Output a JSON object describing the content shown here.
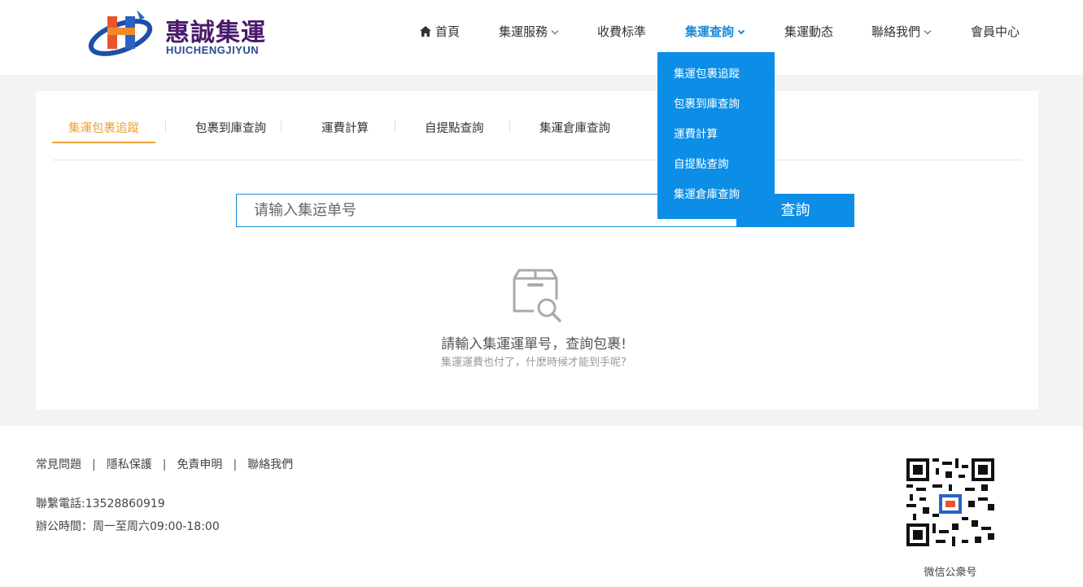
{
  "brand": {
    "name_cn": "惠誠集運",
    "name_en": "HUICHENGJIYUN"
  },
  "nav": {
    "home": "首頁",
    "services": "集運服務",
    "pricing": "收費标準",
    "query": "集運查詢",
    "news": "集運動态",
    "contact": "聯絡我們",
    "member": "會員中心"
  },
  "dropdown": {
    "items": [
      "集運包裹追蹤",
      "包裹到庫查詢",
      "運費計算",
      "自提點查詢",
      "集運倉庫查詢"
    ]
  },
  "tabs": {
    "items": [
      "集運包裹追蹤",
      "包裹到庫查詢",
      "運費計算",
      "自提點查詢",
      "集運倉庫查詢"
    ],
    "active_index": 0
  },
  "search": {
    "placeholder": "请输入集运单号",
    "value": "",
    "button": "查詢"
  },
  "empty_state": {
    "icon": "box-search-icon",
    "title": "請輸入集運運單号，查詢包裹!",
    "subtitle": "集運運費也付了，什麼時候才能到手呢?"
  },
  "footer": {
    "links": [
      "常見問題",
      "隱私保護",
      "免責申明",
      "聯絡我們"
    ],
    "phone": "聯繫電話:13528860919",
    "hours": "辦公時間：周一至周六09:00-18:00",
    "qr_label": "微信公衆号"
  },
  "colors": {
    "primary": "#0d8ee6",
    "tab_active": "#e6a23c",
    "page_bg": "#f3f3f3"
  }
}
